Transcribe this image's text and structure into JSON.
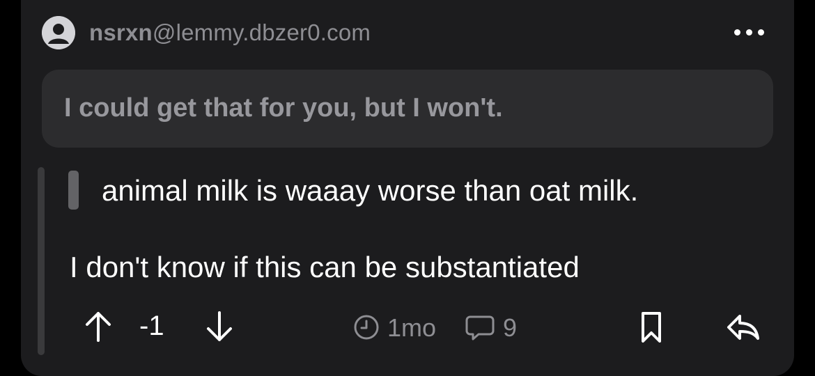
{
  "post": {
    "username": "nsrxn",
    "instance": "@lemmy.dbzer0.com",
    "title": "I could get that for you, but I won't.",
    "quote": "animal milk is waaay worse than oat milk.",
    "body": "I don't know if this can be substantiated"
  },
  "actions": {
    "score": "-1",
    "age": "1mo",
    "replies": "9"
  },
  "icons": {
    "avatar": "avatar-person-icon",
    "more": "more-horizontal-icon",
    "upvote": "arrow-up-icon",
    "downvote": "arrow-down-icon",
    "age": "clock-icon",
    "replies": "comment-bubble-icon",
    "save": "bookmark-icon",
    "reply": "reply-icon"
  },
  "colors": {
    "background": "#000000",
    "card": "#1c1c1e",
    "title_box": "#2c2c2e",
    "muted_text": "#8e8e93",
    "primary_text": "#ffffff"
  }
}
